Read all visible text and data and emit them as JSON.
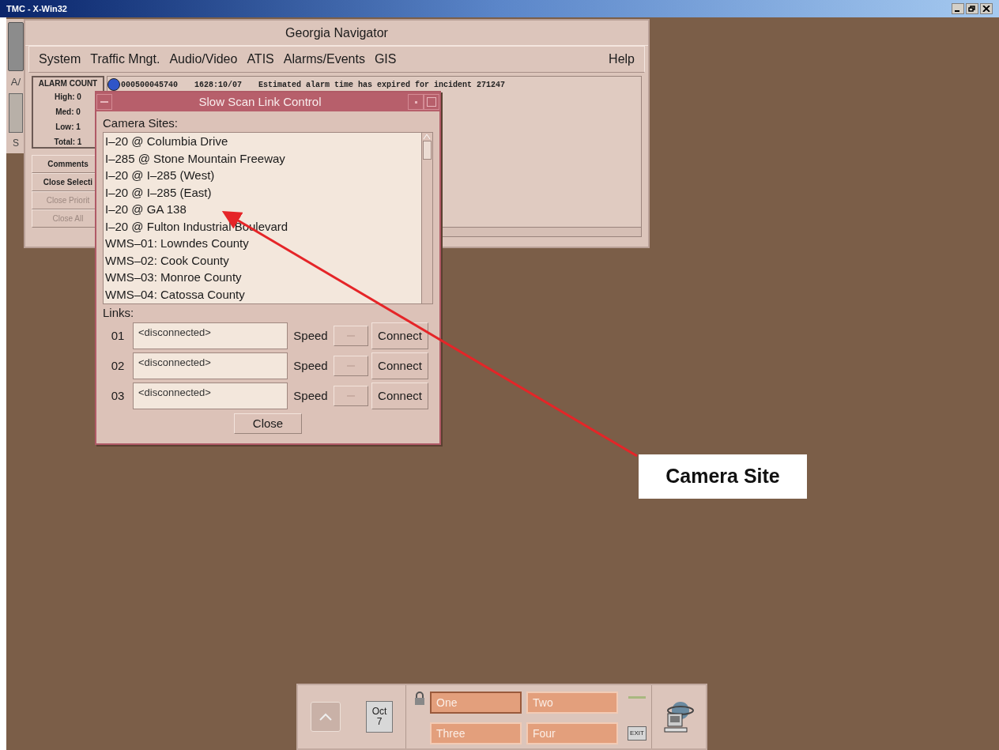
{
  "title_bar": {
    "title": "TMC - X-Win32"
  },
  "background_window": {
    "labels": [
      "A/",
      "S"
    ]
  },
  "navigator": {
    "title": "Georgia Navigator",
    "menu": [
      {
        "label": "System"
      },
      {
        "label": "Traffic Mngt."
      },
      {
        "label": "Audio/Video"
      },
      {
        "label": "ATIS"
      },
      {
        "label": "Alarms/Events"
      },
      {
        "label": "GIS"
      }
    ],
    "help": "Help",
    "alarm_count": {
      "title": "ALARM COUNT",
      "rows": [
        "High: 0",
        "Med: 0",
        "Low: 1",
        "Total: 1"
      ]
    },
    "actions": [
      {
        "label": "Comments",
        "disabled": false
      },
      {
        "label": "Close Selecti",
        "disabled": false
      },
      {
        "label": "Close Priorit",
        "disabled": true
      },
      {
        "label": "Close All",
        "disabled": true
      }
    ],
    "alarms": [
      {
        "color": "#2f55c8",
        "id": "000500045740",
        "time": "1628:10/07",
        "message": "Estimated alarm time has expired for incident 271247"
      }
    ]
  },
  "dialog": {
    "title": "Slow Scan Link Control",
    "sites_label": "Camera Sites:",
    "sites": [
      "I–20 @ Columbia Drive",
      "I–285 @ Stone Mountain Freeway",
      "I–20 @ I–285 (West)",
      "I–20 @ I–285 (East)",
      "I–20 @ GA 138",
      "I–20 @ Fulton Industrial Boulevard",
      "WMS–01: Lowndes County",
      "WMS–02: Cook County",
      "WMS–03: Monroe County",
      "WMS–04: Catossa County"
    ],
    "links_label": "Links:",
    "links": [
      {
        "number": "01",
        "value": "<disconnected>",
        "speed_label": "Speed",
        "connect": "Connect"
      },
      {
        "number": "02",
        "value": "<disconnected>",
        "speed_label": "Speed",
        "connect": "Connect"
      },
      {
        "number": "03",
        "value": "<disconnected>",
        "speed_label": "Speed",
        "connect": "Connect"
      }
    ],
    "close": "Close"
  },
  "dock": {
    "date": {
      "month": "Oct",
      "day": "7"
    },
    "workspaces": [
      {
        "label": "One",
        "selected": true
      },
      {
        "label": "Two",
        "selected": false
      },
      {
        "label": "Three",
        "selected": false
      },
      {
        "label": "Four",
        "selected": false
      }
    ],
    "exit": "EXIT"
  },
  "callout": {
    "text": "Camera Site"
  }
}
